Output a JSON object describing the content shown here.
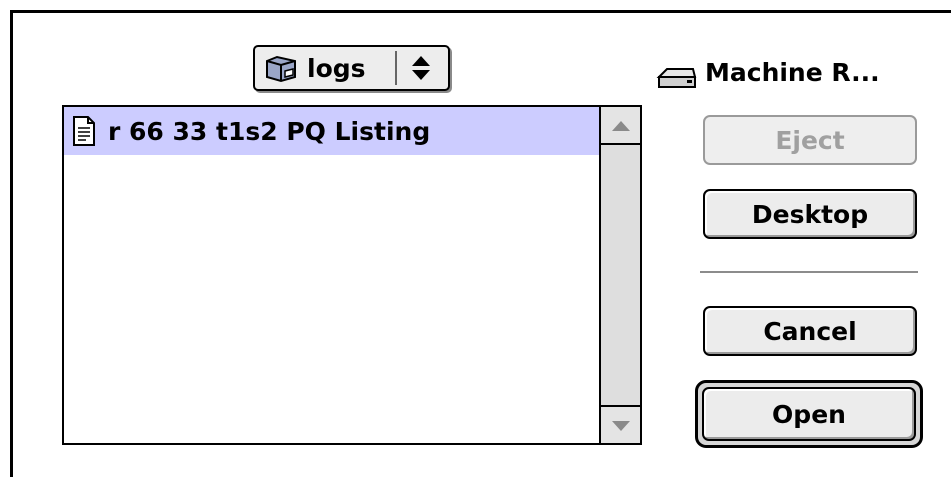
{
  "location_popup": {
    "label": "logs",
    "icon": "folder-icon"
  },
  "file_list": {
    "items": [
      {
        "label": "r 66 33 t1s2 PQ Listing",
        "icon": "document-icon",
        "selected": true
      }
    ]
  },
  "volume": {
    "label": "Machine R...",
    "icon": "hard-drive-icon"
  },
  "buttons": {
    "eject": "Eject",
    "desktop": "Desktop",
    "cancel": "Cancel",
    "open": "Open"
  },
  "colors": {
    "selection": "#ccccff",
    "disabled_text": "#a0a0a0"
  }
}
